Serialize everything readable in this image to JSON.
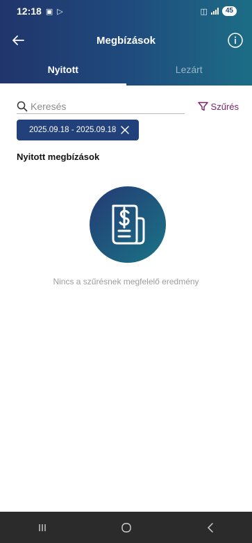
{
  "status": {
    "time": "12:18",
    "battery": "45"
  },
  "header": {
    "title": "Megbízások"
  },
  "tabs": [
    {
      "label": "Nyitott",
      "active": true
    },
    {
      "label": "Lezárt",
      "active": false
    }
  ],
  "search": {
    "placeholder": "Keresés",
    "value": ""
  },
  "filter": {
    "label": "Szűrés"
  },
  "active_filter": {
    "date_range": "2025.09.18 - 2025.09.18"
  },
  "section": {
    "title": "Nyitott megbízások"
  },
  "empty_state": {
    "message": "Nincs a szűrésnek megfelelő eredmény"
  },
  "icons": {
    "back": "arrow-left-icon",
    "info": "info-icon",
    "search": "search-icon",
    "filter": "funnel-icon",
    "chip_close": "close-icon",
    "empty": "invoice-icon",
    "nav_recent": "recent-apps-icon",
    "nav_home": "home-icon",
    "nav_back": "back-icon"
  },
  "colors": {
    "header_start": "#20356b",
    "header_end": "#1d6d86",
    "accent": "#7b1e6a",
    "chip": "#22417a"
  }
}
